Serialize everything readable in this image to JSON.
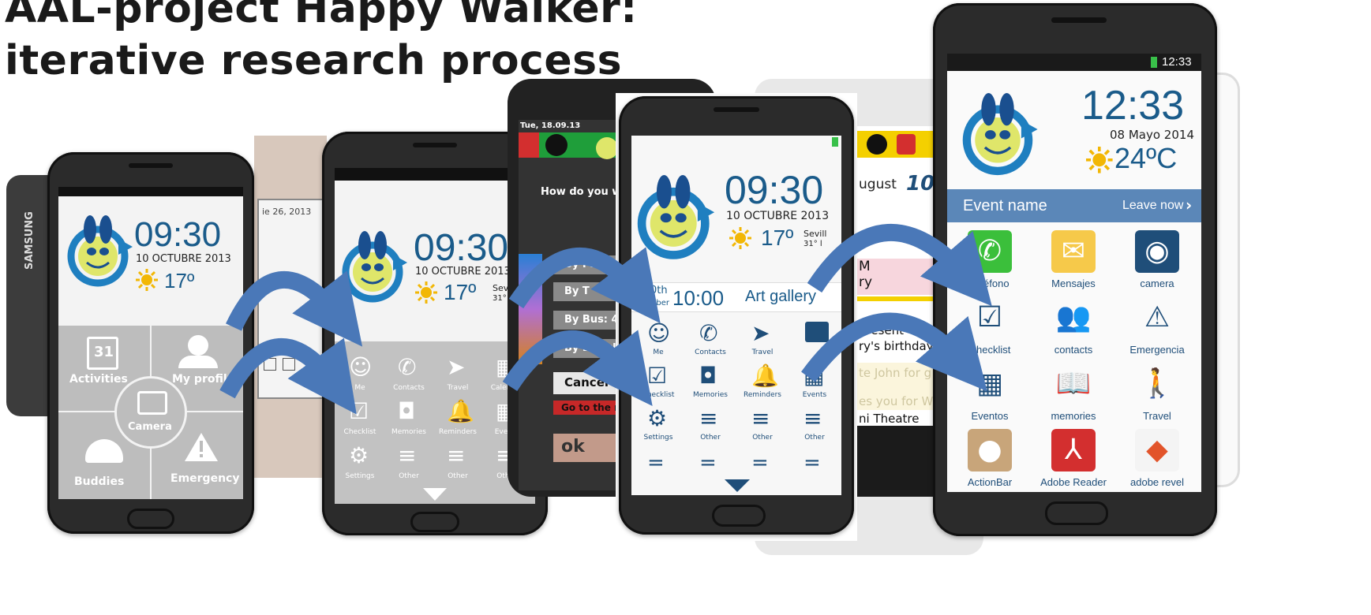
{
  "title": {
    "line1": "AAL-project Happy Walker:",
    "line2": "iterative research process"
  },
  "colors": {
    "brand_blue": "#1f4e79",
    "arrow_blue": "#4a78b8",
    "event_bar": "#5b87b8",
    "screen_gray": "#c2c2c2"
  },
  "phone1": {
    "time": "09:30",
    "date": "10 OCTUBRE 2013",
    "temp": "17º",
    "tiles": {
      "activities": "Activities",
      "calendar_day": "31",
      "profile": "My profil",
      "camera": "Camera",
      "buddies": "Buddies",
      "emergency": "Emergency"
    }
  },
  "bg_paper": {
    "date": "ie 26, 2013"
  },
  "phone2": {
    "time": "09:30",
    "date": "10 OCTUBRE 2013",
    "temp": "17º",
    "city": "Sevil",
    "city_sub": "31° l",
    "items": [
      "Me",
      "Contacts",
      "Travel",
      "Calendar",
      "Checklist",
      "Memories",
      "Reminders",
      "Events",
      "Settings",
      "Other",
      "Other",
      "Other"
    ]
  },
  "bg_phone_dark": {
    "datetime": "Tue, 18.09.13",
    "question": "How do you w",
    "options": [
      "By Foot: 2",
      "By T",
      "By Bus: 4",
      "By Bicycl"
    ],
    "cancel": "Cancel",
    "go": "Go to the n",
    "ok": "ok"
  },
  "phone3": {
    "time": "09:30",
    "date": "10 OCTUBRE 2013",
    "temp": "17º",
    "city": "Sevill",
    "city_sub": "31° l",
    "event": {
      "day": "0th",
      "month": "October",
      "time": "10:00",
      "title": "Art gallery"
    },
    "items": [
      "Me",
      "Contacts",
      "Travel",
      "Checklist",
      "Memories",
      "Reminders",
      "Events",
      "Settings",
      "Other",
      "Other",
      "Other"
    ]
  },
  "bg_phone_white": {
    "month": "ugust",
    "time_digits": "10",
    "lines": [
      "M",
      "ry",
      "present",
      "ry's birthday",
      "te John for g",
      "es you for Wi",
      "ni Theatre"
    ]
  },
  "phone4": {
    "status_time": "12:33",
    "time": "12:33",
    "date": "08 Mayo 2014",
    "temp": "24ºC",
    "event_name": "Event name",
    "leave_now": "Leave now",
    "apps": [
      "Teléfono",
      "Mensajes",
      "camera",
      "Checklist",
      "contacts",
      "Emergencia",
      "Eventos",
      "memories",
      "Travel",
      "ActionBar",
      "Adobe Reader",
      "adobe revel"
    ]
  },
  "icons": [
    "smiley-logo-icon",
    "sun-icon",
    "calendar-icon",
    "person-icon",
    "camera-icon",
    "group-icon",
    "warning-icon",
    "phone-icon",
    "navigation-arrow-icon",
    "bell-icon",
    "gear-icon",
    "menu-icon",
    "checklist-icon",
    "envelope-icon",
    "book-icon",
    "walking-icon",
    "pdf-icon",
    "curved-arrow-icon"
  ]
}
